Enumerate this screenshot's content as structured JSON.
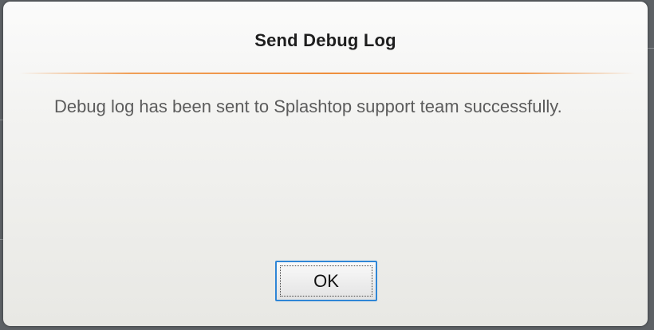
{
  "dialog": {
    "title": "Send Debug Log",
    "message": "Debug log has been sent to Splashtop support team successfully.",
    "ok_label": "OK",
    "accent_color": "#ef8f3c",
    "focus_color": "#2f86d6"
  }
}
